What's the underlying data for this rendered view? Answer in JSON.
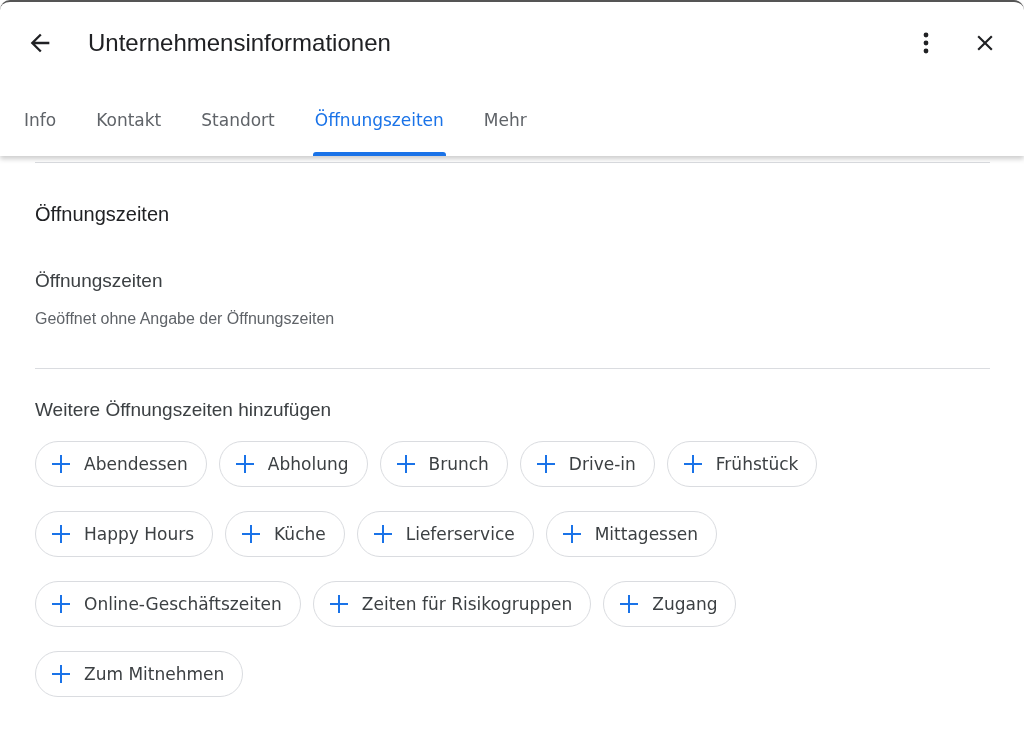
{
  "header": {
    "title": "Unternehmensinformationen"
  },
  "tabs": [
    {
      "label": "Info",
      "selected": false
    },
    {
      "label": "Kontakt",
      "selected": false
    },
    {
      "label": "Standort",
      "selected": false
    },
    {
      "label": "Öffnungszeiten",
      "selected": true
    },
    {
      "label": "Mehr",
      "selected": false
    }
  ],
  "section": {
    "heading": "Öffnungszeiten",
    "field_label": "Öffnungszeiten",
    "field_value": "Geöffnet ohne Angabe der Öffnungszeiten"
  },
  "more_hours": {
    "heading": "Weitere Öffnungszeiten hinzufügen",
    "chips": [
      "Abendessen",
      "Abholung",
      "Brunch",
      "Drive-in",
      "Frühstück",
      "Happy Hours",
      "Küche",
      "Lieferservice",
      "Mittagessen",
      "Online-Geschäftszeiten",
      "Zeiten für Risikogruppen",
      "Zugang",
      "Zum Mitnehmen"
    ]
  }
}
